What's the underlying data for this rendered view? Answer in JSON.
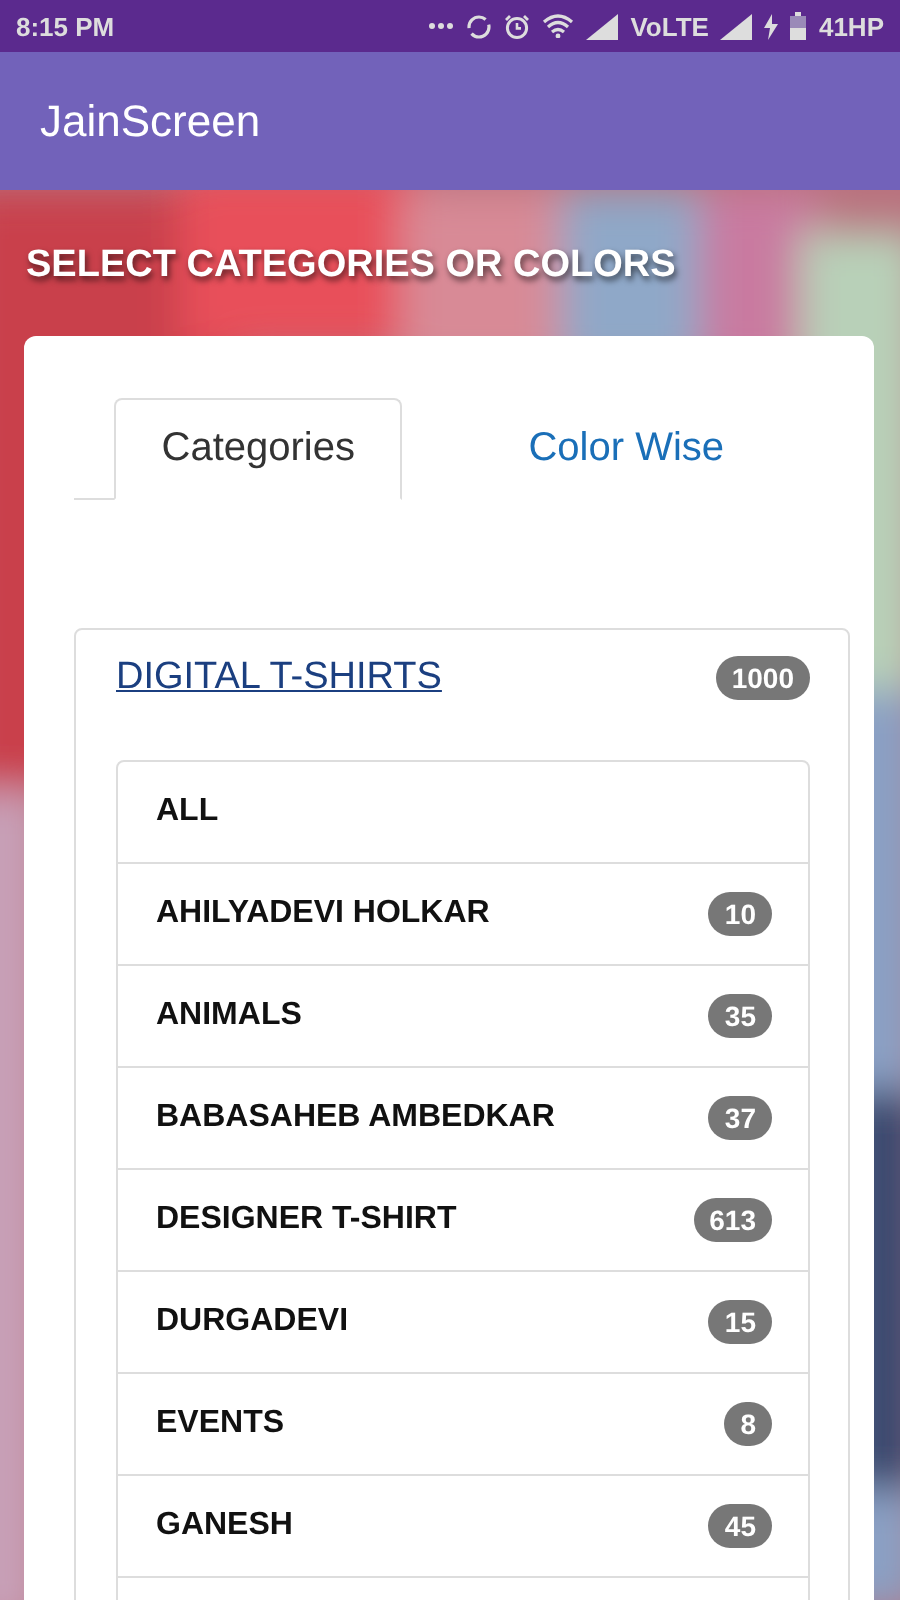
{
  "status_bar": {
    "time": "8:15 PM",
    "network": "VoLTE",
    "battery": "41HP"
  },
  "app_bar": {
    "title": "JainScreen"
  },
  "heading": "SELECT CATEGORIES OR COLORS",
  "tabs": [
    {
      "label": "Categories",
      "selected": true
    },
    {
      "label": "Color Wise",
      "selected": false
    }
  ],
  "group": {
    "title": "DIGITAL T-SHIRTS",
    "count": "1000"
  },
  "items": [
    {
      "label": "ALL"
    },
    {
      "label": "AHILYADEVI HOLKAR",
      "count": "10"
    },
    {
      "label": "ANIMALS",
      "count": "35"
    },
    {
      "label": "BABASAHEB AMBEDKAR",
      "count": "37"
    },
    {
      "label": "DESIGNER T-SHIRT",
      "count": "613"
    },
    {
      "label": "DURGADEVI",
      "count": "15"
    },
    {
      "label": "EVENTS",
      "count": "8"
    },
    {
      "label": "GANESH",
      "count": "45"
    }
  ]
}
